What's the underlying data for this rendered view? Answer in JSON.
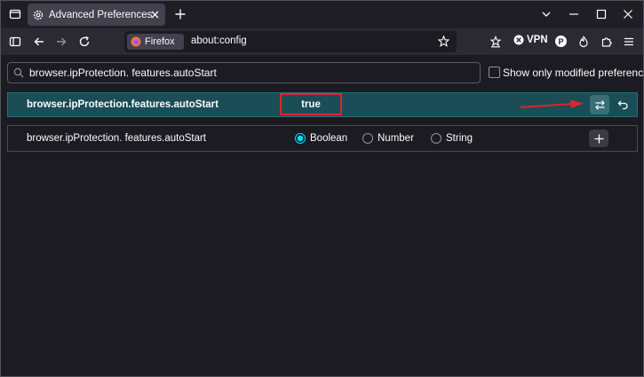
{
  "tab": {
    "title": "Advanced Preferences",
    "icon": "gear-icon"
  },
  "urlbar": {
    "identity_label": "Firefox",
    "url": "about:config"
  },
  "toolbar": {
    "vpn_label": "VPN",
    "profile_badge": "P"
  },
  "search": {
    "value": "browser.ipProtection. features.autoStart",
    "show_modified_label": "Show only modified preferences",
    "show_modified_checked": false
  },
  "pref_row": {
    "name": "browser.ipProtection.features.autoStart",
    "value": "true",
    "highlight_color": "#e0242b"
  },
  "new_pref_row": {
    "name": "browser.ipProtection. features.autoStart",
    "types": [
      "Boolean",
      "Number",
      "String"
    ],
    "selected_type": "Boolean"
  },
  "colors": {
    "accent": "#00ddff",
    "row_highlight": "#1a4d56",
    "annotation": "#e0242b"
  }
}
